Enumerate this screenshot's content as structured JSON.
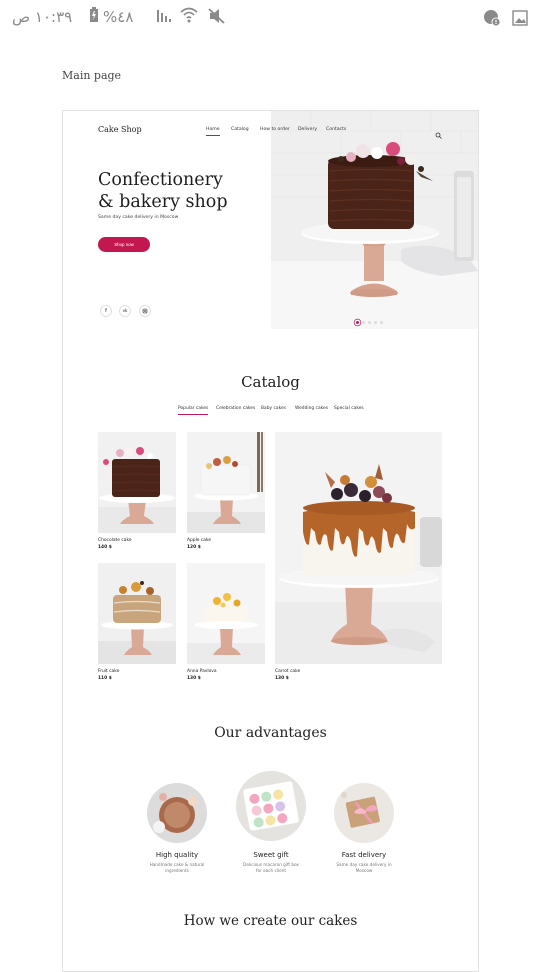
{
  "status_bar": {
    "time": "١٠:٣٩ ص",
    "battery": "%٤٨",
    "icons": [
      "signal-icon",
      "wifi-icon",
      "mute-icon",
      "alert-icon",
      "image-icon"
    ]
  },
  "screen_label": "Main page",
  "site": {
    "logo": "Cake Shop",
    "nav": [
      "Home",
      "Catalog",
      "How to order",
      "Delivery",
      "Contacts"
    ],
    "hero": {
      "title": "Confectionery & bakery shop",
      "subtitle": "Same day cake delivery in Moscow",
      "button": "Shop now"
    },
    "social": [
      "f",
      "vk",
      "ig"
    ],
    "catalog": {
      "title": "Catalog",
      "tabs": [
        "Popular cakes",
        "Celebration cakes",
        "Baby cakes",
        "Wedding cakes",
        "Special cakes"
      ],
      "items": [
        {
          "name": "Chocolate cake",
          "price": "140 $"
        },
        {
          "name": "Apple cake",
          "price": "120 $"
        },
        {
          "name": "Fruit cake",
          "price": "110 $"
        },
        {
          "name": "Anna Pavlova",
          "price": "130 $"
        },
        {
          "name": "Carrot cake",
          "price": "130 $"
        }
      ]
    },
    "advantages": {
      "title": "Our advantages",
      "items": [
        {
          "title": "High quality",
          "text": "Handmade cake & natural ingredients"
        },
        {
          "title": "Sweet gift",
          "text": "Delicious macaron gift box for each client"
        },
        {
          "title": "Fast delivery",
          "text": "Same day cake delivery in Moscow"
        }
      ]
    },
    "how_title": "How we create our cakes"
  },
  "colors": {
    "accent": "#c2184f",
    "chocolate": "#4a2418",
    "caramel": "#b5652a"
  }
}
